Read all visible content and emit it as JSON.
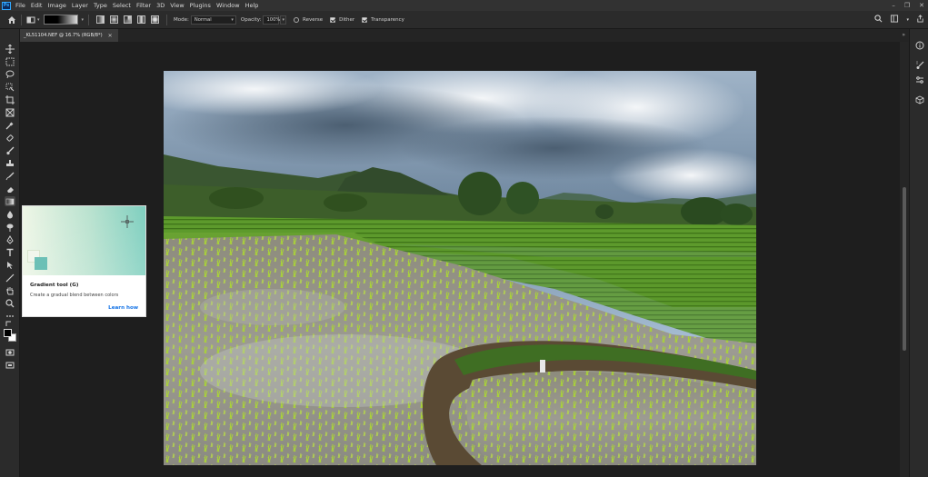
{
  "app": {
    "logo_text": "Ps"
  },
  "menu": {
    "items": [
      "File",
      "Edit",
      "Image",
      "Layer",
      "Type",
      "Select",
      "Filter",
      "3D",
      "View",
      "Plugins",
      "Window",
      "Help"
    ]
  },
  "options": {
    "mode_label": "Mode:",
    "mode_value": "Normal",
    "opacity_label": "Opacity:",
    "opacity_value": "100%",
    "reverse_label": "Reverse",
    "dither_label": "Dither",
    "transparency_label": "Transparency",
    "reverse_checked": false,
    "dither_checked": true,
    "transparency_checked": true
  },
  "document": {
    "tab_label": "_KL51104.NEF @ 16.7% (RGB/8*)"
  },
  "tooltip": {
    "title": "Gradient tool (G)",
    "description": "Create a gradual blend between colors",
    "link": "Learn how"
  },
  "tools": [
    "move-tool-icon",
    "marquee-tool-icon",
    "lasso-tool-icon",
    "object-selection-tool-icon",
    "crop-tool-icon",
    "frame-tool-icon",
    "eyedropper-tool-icon",
    "healing-brush-tool-icon",
    "brush-tool-icon",
    "clone-stamp-tool-icon",
    "history-brush-tool-icon",
    "eraser-tool-icon",
    "gradient-tool-icon",
    "blur-tool-icon",
    "dodge-tool-icon",
    "pen-tool-icon",
    "type-tool-icon",
    "path-selection-tool-icon",
    "rectangle-tool-icon",
    "hand-tool-icon",
    "zoom-tool-icon",
    "more-tools-icon"
  ],
  "colors": {
    "accent": "#1473e6",
    "foreground": "#000000",
    "background": "#ffffff"
  }
}
